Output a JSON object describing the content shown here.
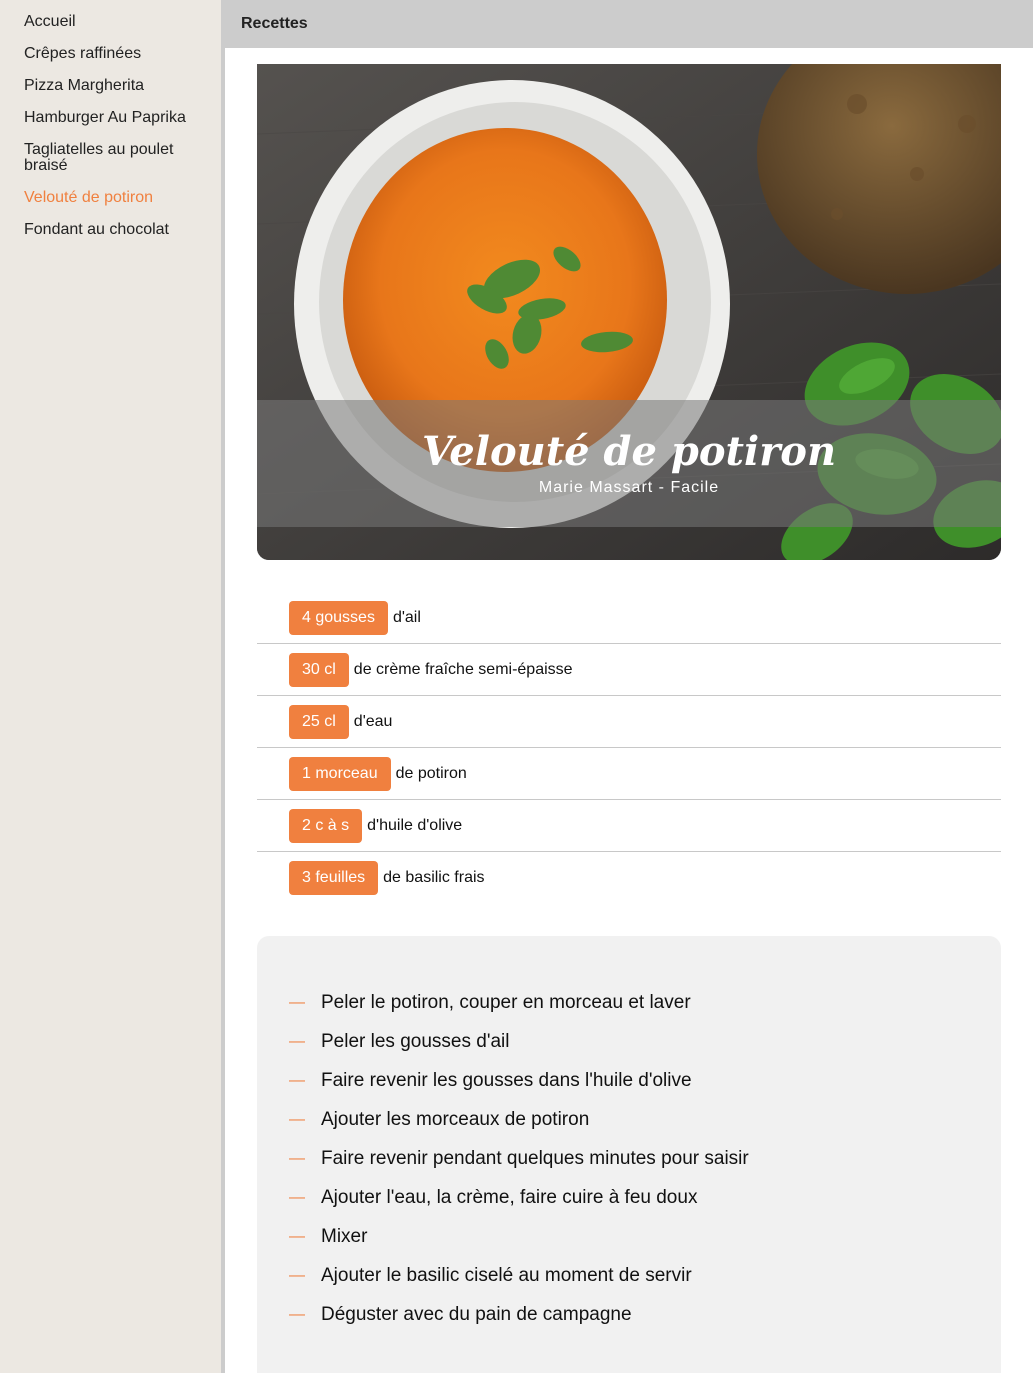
{
  "sidebar": {
    "items": [
      {
        "label": "Accueil"
      },
      {
        "label": "Crêpes raffinées"
      },
      {
        "label": "Pizza Margherita"
      },
      {
        "label": "Hamburger Au Paprika"
      },
      {
        "label": "Tagliatelles au poulet braisé"
      },
      {
        "label": "Velouté de potiron",
        "active": true
      },
      {
        "label": "Fondant au chocolat"
      }
    ]
  },
  "header": {
    "title": "Recettes"
  },
  "recipe": {
    "title": "Velouté de potiron",
    "subtitle": "Marie Massart - Facile",
    "ingredients": [
      {
        "qty": "4 gousses",
        "name": "d'ail"
      },
      {
        "qty": "30 cl",
        "name": "de crème fraîche semi-épaisse"
      },
      {
        "qty": "25 cl",
        "name": "d'eau"
      },
      {
        "qty": "1 morceau",
        "name": "de potiron"
      },
      {
        "qty": "2 c à s",
        "name": "d'huile d'olive"
      },
      {
        "qty": "3 feuilles",
        "name": "de basilic frais"
      }
    ],
    "steps": [
      "Peler le potiron, couper en morceau et laver",
      "Peler les gousses d'ail",
      "Faire revenir les gousses dans l'huile d'olive",
      "Ajouter les morceaux de potiron",
      "Faire revenir pendant quelques minutes pour saisir",
      "Ajouter l'eau, la crème, faire cuire à feu doux",
      "Mixer",
      "Ajouter le basilic ciselé au moment de servir",
      "Déguster avec du pain de campagne"
    ],
    "step_marker": "—"
  },
  "colors": {
    "accent": "#f0803f",
    "sidebar_bg": "#ece8e2",
    "topbar_bg": "#cccccc",
    "steps_bg": "#f1f1f1"
  }
}
